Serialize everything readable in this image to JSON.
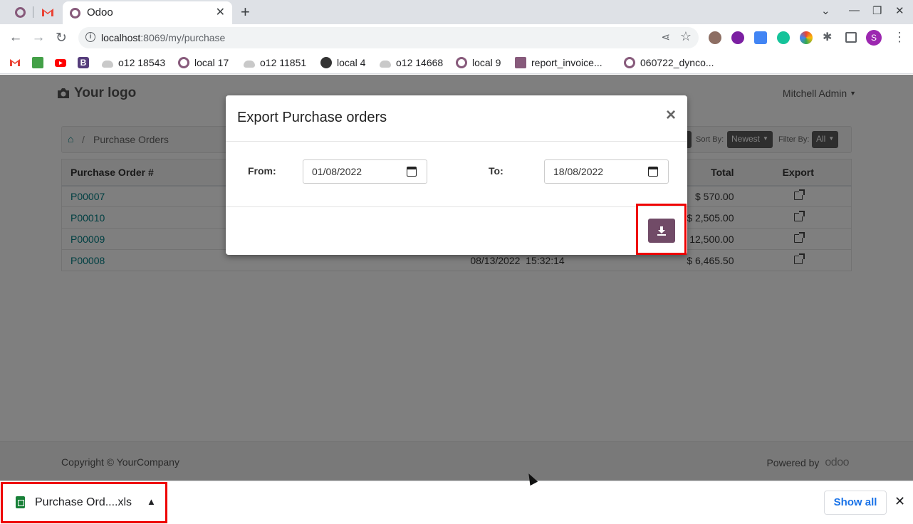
{
  "browser": {
    "active_tab_title": "Odoo",
    "url_host": "localhost",
    "url_path": ":8069/my/purchase",
    "profile_initial": "S",
    "bookmarks": [
      {
        "label": "",
        "icon": "gmail-icon"
      },
      {
        "label": "",
        "icon": "thumbs-up-icon"
      },
      {
        "label": "",
        "icon": "youtube-icon"
      },
      {
        "label": "",
        "icon": "bootstrap-icon"
      },
      {
        "label": "o12 18543",
        "icon": "cloud-icon"
      },
      {
        "label": "local 17",
        "icon": "odoo-ring-icon"
      },
      {
        "label": "o12 11851",
        "icon": "cloud-icon"
      },
      {
        "label": "local 4",
        "icon": "globe-icon"
      },
      {
        "label": "o12 14668",
        "icon": "cloud-icon"
      },
      {
        "label": "local 9",
        "icon": "odoo-ring-icon"
      },
      {
        "label": "report_invoice...",
        "icon": "odoo-square-icon"
      },
      {
        "label": "060722_dynco...",
        "icon": "odoo-ring-icon"
      }
    ]
  },
  "site": {
    "logo_text": "Your logo",
    "user_name": "Mitchell Admin",
    "breadcrumb": "Purchase Orders",
    "sort_label": "Sort By:",
    "sort_value": "Newest",
    "filter_label": "Filter By:",
    "filter_value": "All",
    "table": {
      "headers": {
        "order": "Purchase Order #",
        "total": "Total",
        "export": "Export"
      },
      "rows": [
        {
          "order": "P00007",
          "date": "",
          "total": "$ 570.00"
        },
        {
          "order": "P00010",
          "date": "",
          "total": "$ 2,505.00"
        },
        {
          "order": "P00009",
          "date": "",
          "total": "$ 12,500.00"
        },
        {
          "order": "P00008",
          "date": "08/13/2022  15:32:14",
          "total": "$ 6,465.50"
        }
      ]
    },
    "footer": {
      "copyright": "Copyright © YourCompany",
      "powered_by": "Powered by",
      "brand": "odoo"
    }
  },
  "modal": {
    "title": "Export Purchase orders",
    "from_label": "From:",
    "from_value": "01/08/2022",
    "to_label": "To:",
    "to_value": "18/08/2022"
  },
  "downloads": {
    "file_name": "Purchase Ord....xls",
    "show_all": "Show all"
  },
  "colors": {
    "odoo_primary": "#714b67",
    "link_teal": "#017e84",
    "highlight": "#ee0000"
  }
}
